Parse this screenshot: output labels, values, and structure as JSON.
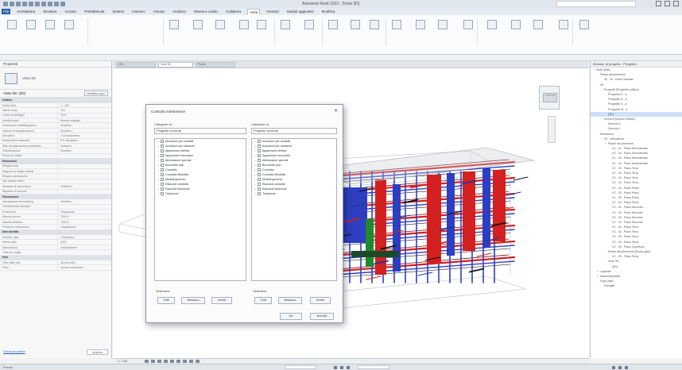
{
  "window": {
    "title": "Autodesk Revit 2023 - [Vista 3D]"
  },
  "ribbon": {
    "tabs": [
      "File",
      "Architettura",
      "Strutture",
      "Acciaio",
      "Prefabbricati",
      "Sistemi",
      "Inserisci",
      "Annota",
      "Analizza",
      "Massa e solido",
      "Collabora",
      "Vista",
      "Gestisci",
      "Moduli aggiuntivi",
      "Modifica"
    ],
    "active_tab": "Vista"
  },
  "properties": {
    "header": "Proprietà",
    "type_label": "Vista 3D",
    "instance_label": "Vista 3D: {3D}",
    "edit_type": "Modifica tipo",
    "footer_link": "Guida proprietà",
    "apply": "Applica",
    "rows": [
      {
        "group": true,
        "label": "Grafica"
      },
      {
        "label": "Scala vista",
        "value": "1 : 100"
      },
      {
        "label": "Valore scala",
        "value": "100"
      },
      {
        "label": "Livello di dettaglio",
        "value": "Fine"
      },
      {
        "label": "Visibilità parti",
        "value": "Mostra originale"
      },
      {
        "label": "Sostituzioni visibilità/grafica",
        "value": "Modifica..."
      },
      {
        "label": "Opzioni di visualizzazione",
        "value": "Modifica..."
      },
      {
        "label": "Disciplina",
        "value": "Coordinamento"
      },
      {
        "label": "Mostra linee nascoste",
        "value": "Per disciplina"
      },
      {
        "label": "Stile visualizzazione predefinito",
        "value": "Nessuno"
      },
      {
        "label": "Sottodisciplina",
        "value": "Modifica..."
      },
      {
        "label": "Percorso solare",
        "value": ""
      },
      {
        "group": true,
        "label": "Estensioni"
      },
      {
        "label": "Ritaglia vista",
        "value": ""
      },
      {
        "label": "Regione di ritaglio visibile",
        "value": ""
      },
      {
        "label": "Ritaglio annotazione",
        "value": ""
      },
      {
        "label": "Clip lontano attivo",
        "value": ""
      },
      {
        "label": "Distanza di clip lontano",
        "value": "304800.0"
      },
      {
        "label": "Riquadro di sezione",
        "value": ""
      },
      {
        "group": true,
        "label": "Fotocamera"
      },
      {
        "label": "Impostazioni di rendering",
        "value": "Modifica..."
      },
      {
        "label": "Orientamento bloccato",
        "value": ""
      },
      {
        "label": "Proiezione",
        "value": "Ortogonale"
      },
      {
        "label": "Altezza occhio",
        "value": "7000.0"
      },
      {
        "label": "Altezza obiettivo",
        "value": "7000.0"
      },
      {
        "label": "Posizione fotocamera",
        "value": "Regolazione"
      },
      {
        "group": true,
        "label": "Dati identità"
      },
      {
        "label": "Modello vista",
        "value": "<Nessuno>"
      },
      {
        "label": "Nome vista",
        "value": "{3D}"
      },
      {
        "label": "Dipendenza",
        "value": "Indipendente"
      },
      {
        "label": "Titolo sul foglio",
        "value": ""
      },
      {
        "group": true,
        "label": "Fasi"
      },
      {
        "label": "Filtro delle fasi",
        "value": "Mostra tutto"
      },
      {
        "label": "Fase",
        "value": "Nuova costruzione"
      }
    ]
  },
  "view_tabs": [
    "{3D}",
    "Vista 3D",
    "Pianta"
  ],
  "viewcube": {
    "face": "FRONTE"
  },
  "view_control": {
    "scale": "1 : 100"
  },
  "dialog": {
    "title": "Controllo interferenze",
    "left": {
      "label": "Categorie di:",
      "dropdown": "Progetto corrente"
    },
    "right": {
      "label": "Categorie di:",
      "dropdown": "Progetto corrente"
    },
    "items": [
      "Accessori per condotti",
      "Accessori per tubazioni",
      "Apparecchi elettrici",
      "Apparecchi meccanici",
      "Attrezzature speciali",
      "Bocchette aria",
      "Condotto",
      "Condotto flessibile",
      "Modelli generici",
      "Raccordi condotto",
      "Raccordi tubazione",
      "Tubazione"
    ],
    "selection_label": "Selezione",
    "btn_all": "Tutti",
    "btn_none": "Nessuno",
    "btn_invert": "Inverti",
    "btn_ok": "OK",
    "btn_cancel": "Annulla"
  },
  "browser": {
    "header": "Browser di progetto - Progetto1",
    "nodes": [
      {
        "d": 0,
        "t": "[-]",
        "label": "Viste (tutte)"
      },
      {
        "d": 1,
        "t": "[-]",
        "label": "Piante dei pavimenti"
      },
      {
        "d": 2,
        "t": "",
        "label": "00 - 00 - Piano Interrato"
      },
      {
        "d": 1,
        "t": "[-]",
        "label": "3D"
      },
      {
        "d": 2,
        "t": "[-]",
        "label": "Prospetti (Prospetto edificio)"
      },
      {
        "d": 3,
        "t": "",
        "label": "Prospetto E - a"
      },
      {
        "d": 3,
        "t": "",
        "label": "Prospetto N - a"
      },
      {
        "d": 3,
        "t": "",
        "label": "Prospetto S - a"
      },
      {
        "d": 3,
        "t": "",
        "label": "Prospetto W - a"
      },
      {
        "d": 3,
        "t": "",
        "label": "{3D}"
      },
      {
        "d": 2,
        "t": "[-]",
        "label": "Sezioni (Sezione edificio)"
      },
      {
        "d": 3,
        "t": "",
        "label": "Sezione 0"
      },
      {
        "d": 3,
        "t": "",
        "label": "Sezione 1"
      },
      {
        "d": 1,
        "t": "[-]",
        "label": "Meccanica"
      },
      {
        "d": 2,
        "t": "[-]",
        "label": "VC - Meccanica"
      },
      {
        "d": 3,
        "t": "[-]",
        "label": "Piante dei pavimenti"
      },
      {
        "d": 4,
        "t": "",
        "label": "VC - 01 - Piano Seminterrato"
      },
      {
        "d": 4,
        "t": "",
        "label": "VC - 02 - Piano Seminterrato"
      },
      {
        "d": 4,
        "t": "",
        "label": "VC - 03 - Piano Seminterrato"
      },
      {
        "d": 4,
        "t": "",
        "label": "VC - 04 - Piano Seminterrato"
      },
      {
        "d": 4,
        "t": "",
        "label": "VC - 01 - Piano Terra"
      },
      {
        "d": 4,
        "t": "",
        "label": "VC - 02 - Piano Terra"
      },
      {
        "d": 4,
        "t": "",
        "label": "VC - 03 - Piano Terra"
      },
      {
        "d": 4,
        "t": "",
        "label": "VC - 04 - Piano Terra"
      },
      {
        "d": 4,
        "t": "",
        "label": "VC - 01 - Piano Primo"
      },
      {
        "d": 4,
        "t": "",
        "label": "VC - 02 - Piano Primo"
      },
      {
        "d": 4,
        "t": "",
        "label": "VC - 03 - Piano Primo"
      },
      {
        "d": 4,
        "t": "",
        "label": "VC - 04 - Piano Primo"
      },
      {
        "d": 4,
        "t": "",
        "label": "VC - 01 - Piano Secondo"
      },
      {
        "d": 4,
        "t": "",
        "label": "VC - 02 - Piano Secondo"
      },
      {
        "d": 4,
        "t": "",
        "label": "VC - 03 - Piano Secondo"
      },
      {
        "d": 4,
        "t": "",
        "label": "VC - 04 - Piano Secondo"
      },
      {
        "d": 4,
        "t": "",
        "label": "VC - 01 - Piano Terzo"
      },
      {
        "d": 4,
        "t": "",
        "label": "VC - 02 - Piano Terzo"
      },
      {
        "d": 4,
        "t": "",
        "label": "VC - 03 - Piano Terzo"
      },
      {
        "d": 4,
        "t": "",
        "label": "VC - 04 - Piano Terzo"
      },
      {
        "d": 4,
        "t": "",
        "label": "VC - 00 - Piano Copertura"
      },
      {
        "d": 3,
        "t": "[-]",
        "label": "Piante dei pavimenti (Tavola plani)"
      },
      {
        "d": 4,
        "t": "",
        "label": "VC - 00 - Piano Terra"
      },
      {
        "d": 3,
        "t": "[-]",
        "label": "Viste 3D"
      },
      {
        "d": 4,
        "t": "",
        "label": "{3D}"
      },
      {
        "d": 1,
        "t": "[+]",
        "label": "Legende"
      },
      {
        "d": 1,
        "t": "[+]",
        "label": "Abachi/Quantità"
      },
      {
        "d": 1,
        "t": "[-]",
        "label": "Fogli (tutti)"
      },
      {
        "d": 2,
        "t": "",
        "label": "Famiglie"
      }
    ]
  },
  "statusbar": {
    "text": "Pronto"
  },
  "colors": {
    "accent": "#2a60a8",
    "selection": "#cde0f7",
    "pipe_red": "#d32020",
    "pipe_blue": "#2d3fc0",
    "pipe_green": "#1f8a2e"
  }
}
